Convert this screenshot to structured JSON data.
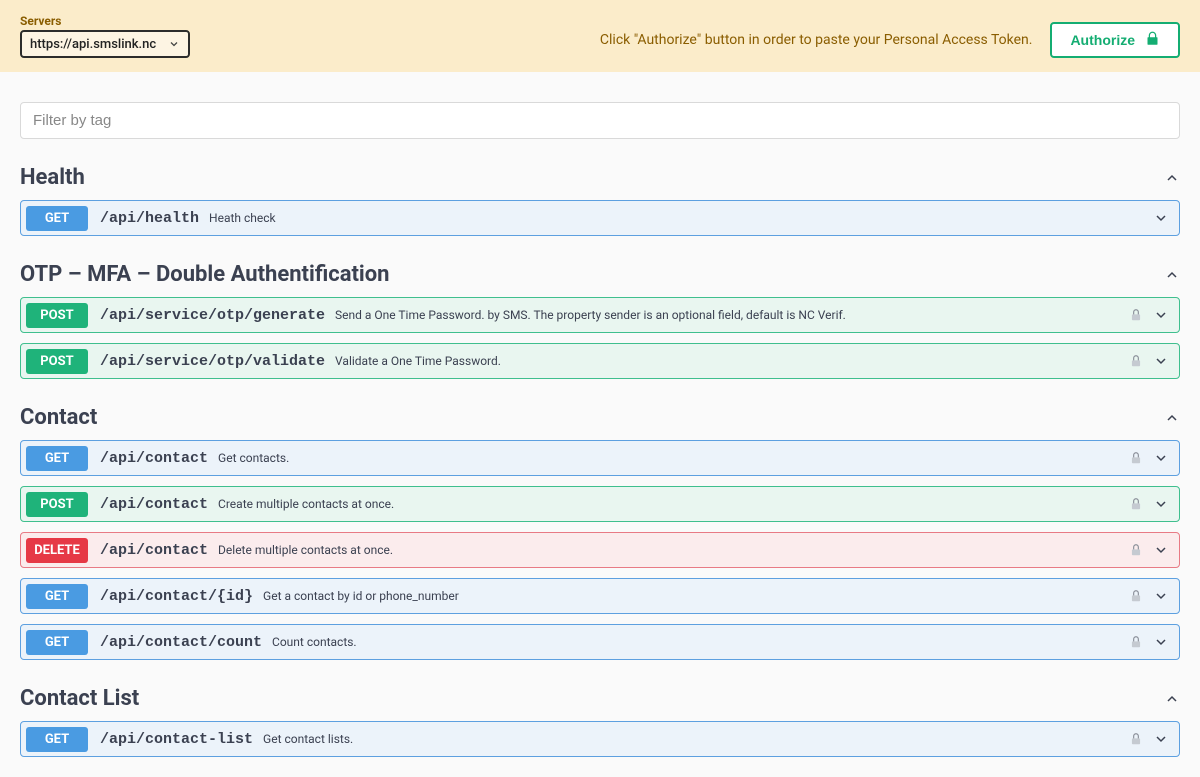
{
  "top_bar": {
    "servers_label": "Servers",
    "selected_server": "https://api.smslink.nc",
    "auth_hint": "Click \"Authorize\" button in order to paste your Personal Access Token.",
    "authorize_label": "Authorize"
  },
  "filter": {
    "placeholder": "Filter by tag"
  },
  "sections": [
    {
      "title": "Health",
      "ops": [
        {
          "method": "GET",
          "path": "/api/health",
          "summary": "Heath check",
          "locked": false
        }
      ]
    },
    {
      "title": "OTP – MFA – Double Authentification",
      "ops": [
        {
          "method": "POST",
          "path": "/api/service/otp/generate",
          "summary": "Send a One Time Password. by SMS. The property sender is an optional field, default is NC Verif.",
          "locked": true
        },
        {
          "method": "POST",
          "path": "/api/service/otp/validate",
          "summary": "Validate a One Time Password.",
          "locked": true
        }
      ]
    },
    {
      "title": "Contact",
      "ops": [
        {
          "method": "GET",
          "path": "/api/contact",
          "summary": "Get contacts.",
          "locked": true
        },
        {
          "method": "POST",
          "path": "/api/contact",
          "summary": "Create multiple contacts at once.",
          "locked": true
        },
        {
          "method": "DELETE",
          "path": "/api/contact",
          "summary": "Delete multiple contacts at once.",
          "locked": true
        },
        {
          "method": "GET",
          "path": "/api/contact/{id}",
          "summary": "Get a contact by id or phone_number",
          "locked": true
        },
        {
          "method": "GET",
          "path": "/api/contact/count",
          "summary": "Count contacts.",
          "locked": true
        }
      ]
    },
    {
      "title": "Contact List",
      "ops": [
        {
          "method": "GET",
          "path": "/api/contact-list",
          "summary": "Get contact lists.",
          "locked": true
        }
      ]
    }
  ]
}
